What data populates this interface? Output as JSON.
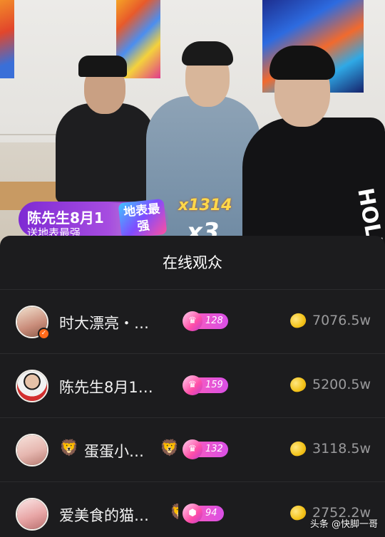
{
  "stream": {
    "gift": {
      "sender": "陈先生8月1",
      "description": "送地表最强",
      "gift_name": "地表最强",
      "count": "x1314",
      "multiplier": "x3"
    },
    "shirt_text": "HOLLO"
  },
  "audience_panel": {
    "title": "在线观众",
    "viewers": [
      {
        "name": "时大漂亮・…",
        "level": "128",
        "amount": "7076.5w",
        "verified": true,
        "avatar_color": "#c98c7a",
        "has_lion": false
      },
      {
        "name": "陈先生8月1…",
        "level": "159",
        "amount": "5200.5w",
        "verified": false,
        "avatar_color": "#d9d9d9",
        "has_lion": false
      },
      {
        "name": "蛋蛋小…",
        "level": "132",
        "amount": "3118.5w",
        "verified": false,
        "avatar_color": "#e6b7b0",
        "has_lion": true
      },
      {
        "name": "爱美食的猫…",
        "level": "94",
        "amount": "2752.2w",
        "verified": false,
        "avatar_color": "#e8a6a6",
        "has_lion": false
      }
    ]
  },
  "watermark": "头条 @快脚一哥",
  "colors": {
    "sheet_bg": "#1c1c1e",
    "badge_pink": "#ff5fb4",
    "coin_gold": "#f3c31a",
    "gift_purple": "#a64ce0"
  }
}
